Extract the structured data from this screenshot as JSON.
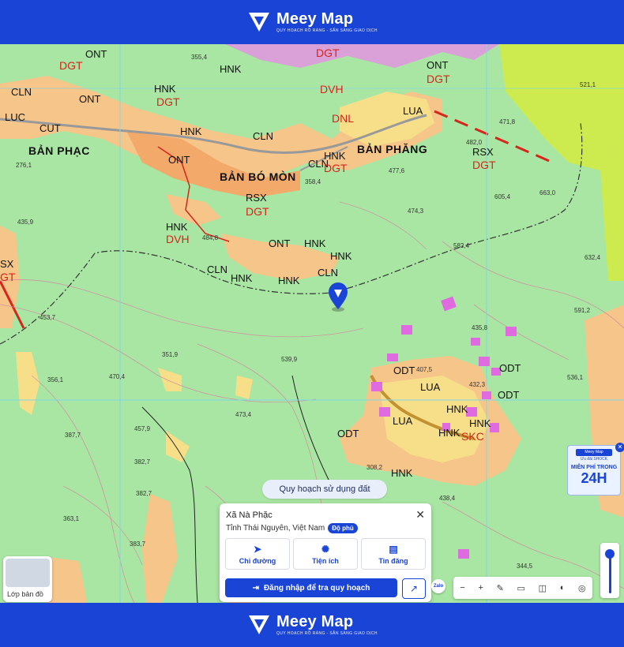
{
  "brand": {
    "name": "Meey Map",
    "tagline": "QUY HOẠCH RÕ RÀNG - SẴN SÀNG GIAO DỊCH"
  },
  "map": {
    "land_labels": [
      {
        "t": "DGT",
        "c": "red"
      },
      {
        "t": "ONT",
        "c": "black"
      },
      {
        "t": "DGT",
        "c": "red"
      },
      {
        "t": "HNK",
        "c": "black"
      },
      {
        "t": "DVH",
        "c": "red"
      },
      {
        "t": "ONT",
        "c": "black"
      },
      {
        "t": "DGT",
        "c": "red"
      },
      {
        "t": "HNK",
        "c": "black"
      },
      {
        "t": "DGT",
        "c": "red"
      },
      {
        "t": "LUA",
        "c": "black"
      },
      {
        "t": "DNL",
        "c": "red"
      },
      {
        "t": "CLN",
        "c": "black"
      },
      {
        "t": "ONT",
        "c": "black"
      },
      {
        "t": "LUC",
        "c": "black"
      },
      {
        "t": "CUT",
        "c": "black"
      },
      {
        "t": "HNK",
        "c": "black"
      },
      {
        "t": "CLN",
        "c": "black"
      },
      {
        "t": "ONT",
        "c": "black"
      },
      {
        "t": "CLN",
        "c": "black"
      },
      {
        "t": "HNK",
        "c": "black"
      },
      {
        "t": "DGT",
        "c": "red"
      },
      {
        "t": "RSX",
        "c": "black"
      },
      {
        "t": "DGT",
        "c": "red"
      },
      {
        "t": "RSX",
        "c": "black"
      },
      {
        "t": "DGT",
        "c": "red"
      },
      {
        "t": "HNK",
        "c": "black"
      },
      {
        "t": "DVH",
        "c": "red"
      },
      {
        "t": "ONT",
        "c": "black"
      },
      {
        "t": "HNK",
        "c": "black"
      },
      {
        "t": "HNK",
        "c": "black"
      },
      {
        "t": "CLN",
        "c": "black"
      },
      {
        "t": "HNK",
        "c": "black"
      },
      {
        "t": "HNK",
        "c": "black"
      },
      {
        "t": "CLN",
        "c": "black"
      },
      {
        "t": "SX",
        "c": "black"
      },
      {
        "t": "GT",
        "c": "red"
      },
      {
        "t": "ODT",
        "c": "black"
      },
      {
        "t": "ODT",
        "c": "black"
      },
      {
        "t": "LUA",
        "c": "black"
      },
      {
        "t": "HNK",
        "c": "black"
      },
      {
        "t": "HNK",
        "c": "black"
      },
      {
        "t": "HNK",
        "c": "black"
      },
      {
        "t": "ODT",
        "c": "black"
      },
      {
        "t": "LUA",
        "c": "black"
      },
      {
        "t": "HNK",
        "c": "black"
      },
      {
        "t": "SKC",
        "c": "red"
      },
      {
        "t": "ODT",
        "c": "black"
      }
    ],
    "place_labels": [
      "BẢN PHẠC",
      "BẢN BÓ MÒN",
      "BẢN PHĂNG"
    ],
    "elevations": [
      "355,4",
      "521,1",
      "471,8",
      "482,0",
      "477,6",
      "663,0",
      "605,4",
      "358,4",
      "474,3",
      "276,1",
      "435,9",
      "484,8",
      "582,4",
      "632,4",
      "453,7",
      "591,2",
      "435,8",
      "351,9",
      "539,9",
      "407,5",
      "470,4",
      "356,1",
      "536,1",
      "457,9",
      "473,4",
      "387,7",
      "382,7",
      "382,7",
      "308,2",
      "432,3",
      "438,4",
      "363,1",
      "383,7",
      "344,5"
    ]
  },
  "search_chip": "Quy hoạch sử dụng đất",
  "info_card": {
    "title": "Xã Nà Phặc",
    "subtitle": "Tỉnh Thái Nguyên, Việt Nam",
    "badge": "Độ phủ",
    "actions": [
      "Chỉ đường",
      "Tiện ích",
      "Tin đăng"
    ],
    "login_button": "Đăng nhập để tra quy hoạch"
  },
  "layer_button": "Lớp bản đồ",
  "zalo": "Zalo",
  "promo": {
    "head": "Meey Map",
    "sub": "Ưu đãi SHOCK",
    "free": "MIỄN PHÍ TRONG",
    "big": "24H"
  },
  "toolbar": [
    "−",
    "+",
    "✎",
    "▭",
    "◫",
    "◐",
    "◎"
  ]
}
